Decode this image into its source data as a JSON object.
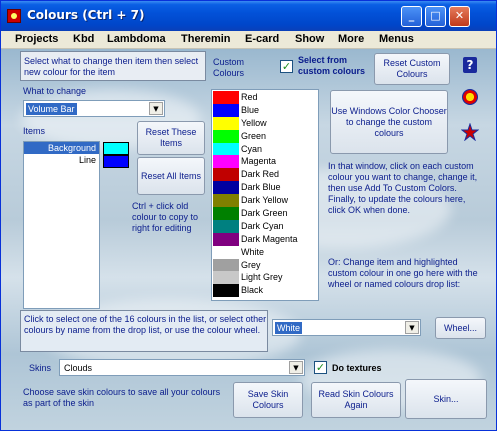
{
  "window": {
    "title": "Colours (Ctrl + 7)",
    "minimize": "_",
    "maximize": "□",
    "close": "✕"
  },
  "menu": [
    "Projects",
    "Kbd",
    "Lambdoma",
    "Theremin",
    "E-card",
    "Show",
    "More",
    "Menus"
  ],
  "instructions": {
    "select_item": "Select what to change then item then select new colour for the item",
    "what_to_change_label": "What to change",
    "items_label": "Items",
    "ctrl_click": "Ctrl + click old colour to copy to right for editing",
    "in_that_window": "In that window, click on each custom colour you want to change,  change it, then use Add To Custom Colors. Finally, to update the colours here, click OK when done.",
    "or_change": "Or: Change item and highlighted custom colour in one go here with the wheel or named colours drop list:",
    "click_to_select": "Click to select one of the 16 colours in the list, or select other colours by name from the drop list, or use the colour wheel.",
    "skins_label": "Skins",
    "choose_save": "Choose save skin colours to save all your colours as part of the skin"
  },
  "what_to_change": {
    "value": "Volume Bar",
    "arrow": "▼"
  },
  "items": [
    {
      "label": "Background",
      "selected": true,
      "swatch": "#00ffff"
    },
    {
      "label": "Line",
      "selected": false,
      "swatch": "#0000ff"
    }
  ],
  "buttons": {
    "reset_these": "Reset These Items",
    "reset_all": "Reset All Items",
    "reset_custom": "Reset Custom Colours",
    "windows_chooser": "Use Windows Color Chooser to change the custom colours",
    "wheel": "Wheel...",
    "save_skin": "Save Skin Colours",
    "read_skin": "Read Skin Colours Again",
    "skin": "Skin..."
  },
  "custom_colours_label": "Custom Colours",
  "select_from_custom": {
    "label": "Select from custom colours",
    "checked": true,
    "mark": "✓"
  },
  "colours": [
    {
      "name": "Red",
      "hex": "#ff0000"
    },
    {
      "name": "Blue",
      "hex": "#0000ff"
    },
    {
      "name": "Yellow",
      "hex": "#ffff00"
    },
    {
      "name": "Green",
      "hex": "#00ff00"
    },
    {
      "name": "Cyan",
      "hex": "#00ffff"
    },
    {
      "name": "Magenta",
      "hex": "#ff00ff"
    },
    {
      "name": "Dark Red",
      "hex": "#c00000"
    },
    {
      "name": "Dark Blue",
      "hex": "#0000a0"
    },
    {
      "name": "Dark Yellow",
      "hex": "#808000"
    },
    {
      "name": "Dark Green",
      "hex": "#008000"
    },
    {
      "name": "Dark Cyan",
      "hex": "#008080"
    },
    {
      "name": "Dark Magenta",
      "hex": "#800080"
    },
    {
      "name": "White",
      "hex": "#ffffff"
    },
    {
      "name": "Grey",
      "hex": "#a0a0a0"
    },
    {
      "name": "Light Grey",
      "hex": "#c8c8c8"
    },
    {
      "name": "Black",
      "hex": "#000000"
    }
  ],
  "named_colour": {
    "value": "White",
    "arrow": "▼"
  },
  "skins": {
    "value": "Clouds",
    "arrow": "▼"
  },
  "do_textures": {
    "label": "Do textures",
    "checked": true,
    "mark": "✓"
  },
  "side_icons": [
    "help-icon",
    "circle-target-icon",
    "star-tool-icon"
  ],
  "help_glyph": "?"
}
